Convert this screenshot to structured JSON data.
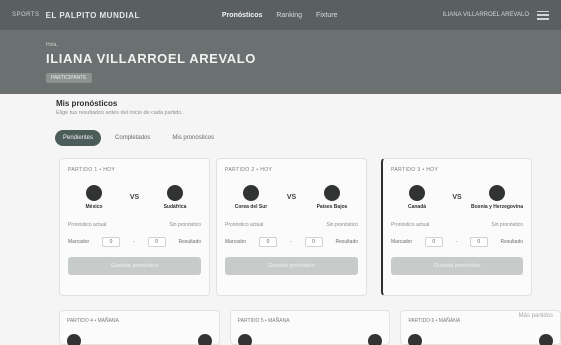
{
  "topbar": {
    "brand_prefix": "SPORTS",
    "brand_name": "EL PALPITO MUNDIAL",
    "nav": [
      "Pronósticos",
      "Ranking",
      "Fixture"
    ],
    "user": "ILIANA VILLARROEL AREVALO",
    "menu_icon": "menu-icon"
  },
  "hero": {
    "kicker": "Hola,",
    "name": "ILIANA VILLARROEL AREVALO",
    "badge": "PARTICIPANTE"
  },
  "main": {
    "title": "Mis pronósticos",
    "subtitle": "Elige tus resultados antes del inicio de cada partido."
  },
  "tabs": [
    "Pendientes",
    "Completados",
    "Mis pronósticos"
  ],
  "cards": [
    {
      "date": "PARTIDO 1 • HOY",
      "home": "México",
      "away": "Sudáfrica",
      "vs": "VS",
      "pred_label": "Pronóstico actual",
      "pred_value": "Sin pronóstico",
      "score_label": "Marcador",
      "score_home": "0",
      "score_away": "0",
      "score_suffix": "Resultado",
      "button": "Guardar pronóstico"
    },
    {
      "date": "PARTIDO 2 • HOY",
      "home": "Corea del Sur",
      "away": "Países Bajos",
      "vs": "VS",
      "pred_label": "Pronóstico actual",
      "pred_value": "Sin pronóstico",
      "score_label": "Marcador",
      "score_home": "0",
      "score_away": "0",
      "score_suffix": "Resultado",
      "button": "Guardar pronóstico"
    },
    {
      "date": "PARTIDO 3 • HOY",
      "home": "Canadá",
      "away": "Bosnia y Herzegovina",
      "vs": "VS",
      "pred_label": "Pronóstico actual",
      "pred_value": "Sin pronóstico",
      "score_label": "Marcador",
      "score_home": "0",
      "score_away": "0",
      "score_suffix": "Resultado",
      "button": "Guardar pronóstico"
    }
  ],
  "mini_cards": [
    {
      "date": "PARTIDO 4 • MAÑANA"
    },
    {
      "date": "PARTIDO 5 • MAÑANA"
    },
    {
      "date": "PARTIDO 6 • MAÑANA"
    }
  ],
  "side_note": "Más partidos"
}
